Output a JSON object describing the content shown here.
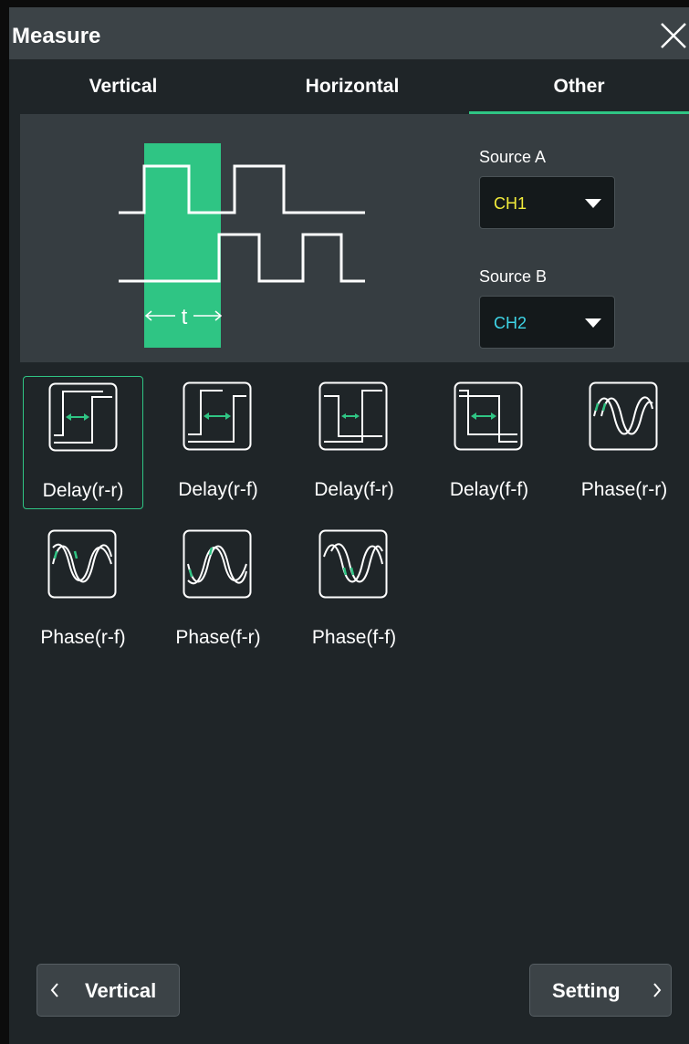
{
  "window": {
    "title": "Measure"
  },
  "tabs": [
    {
      "label": "Vertical",
      "active": false
    },
    {
      "label": "Horizontal",
      "active": false
    },
    {
      "label": "Other",
      "active": true
    }
  ],
  "diagram": {
    "time_label": "t"
  },
  "source_a": {
    "label": "Source A",
    "value": "CH1",
    "color": "#f2ec3b"
  },
  "source_b": {
    "label": "Source B",
    "value": "CH2",
    "color": "#3fd6e8"
  },
  "measurements": [
    {
      "label": "Delay(r-r)",
      "icon": "delay-rise-rise-icon",
      "selected": true
    },
    {
      "label": "Delay(r-f)",
      "icon": "delay-rise-fall-icon",
      "selected": false
    },
    {
      "label": "Delay(f-r)",
      "icon": "delay-fall-rise-icon",
      "selected": false
    },
    {
      "label": "Delay(f-f)",
      "icon": "delay-fall-fall-icon",
      "selected": false
    },
    {
      "label": "Phase(r-r)",
      "icon": "phase-rise-rise-icon",
      "selected": false
    },
    {
      "label": "Phase(r-f)",
      "icon": "phase-rise-fall-icon",
      "selected": false
    },
    {
      "label": "Phase(f-r)",
      "icon": "phase-fall-rise-icon",
      "selected": false
    },
    {
      "label": "Phase(f-f)",
      "icon": "phase-fall-fall-icon",
      "selected": false
    }
  ],
  "footer": {
    "prev_label": "Vertical",
    "next_label": "Setting"
  },
  "colors": {
    "accent": "#2fc584",
    "panel": "#1f2528",
    "header": "#3c4347"
  }
}
